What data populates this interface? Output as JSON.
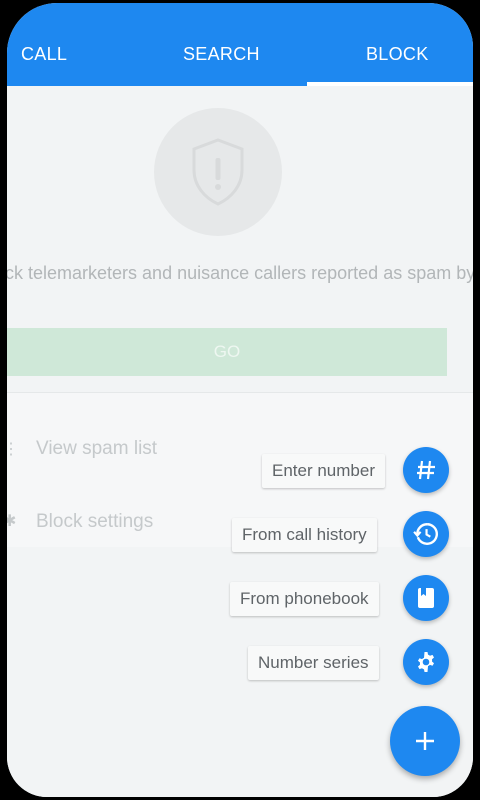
{
  "tabs": {
    "call": "CALL",
    "search": "SEARCH",
    "block": "BLOCK",
    "active": "BLOCK"
  },
  "block_page": {
    "description": "ock telemarketers and nuisance callers reported as spam by others",
    "go_label": "GO",
    "list": {
      "view_spam_list": "View spam list",
      "block_settings": "Block settings"
    }
  },
  "fab_menu": {
    "items": [
      {
        "label": "Enter number",
        "icon": "hash-icon"
      },
      {
        "label": "From call history",
        "icon": "history-icon"
      },
      {
        "label": "From phonebook",
        "icon": "phonebook-icon"
      },
      {
        "label": "Number series",
        "icon": "gear-icon"
      }
    ],
    "main_icon": "plus-icon"
  },
  "colors": {
    "accent": "#1e88f0",
    "go_button": "#cfe8d8",
    "background": "#eef1f2"
  }
}
